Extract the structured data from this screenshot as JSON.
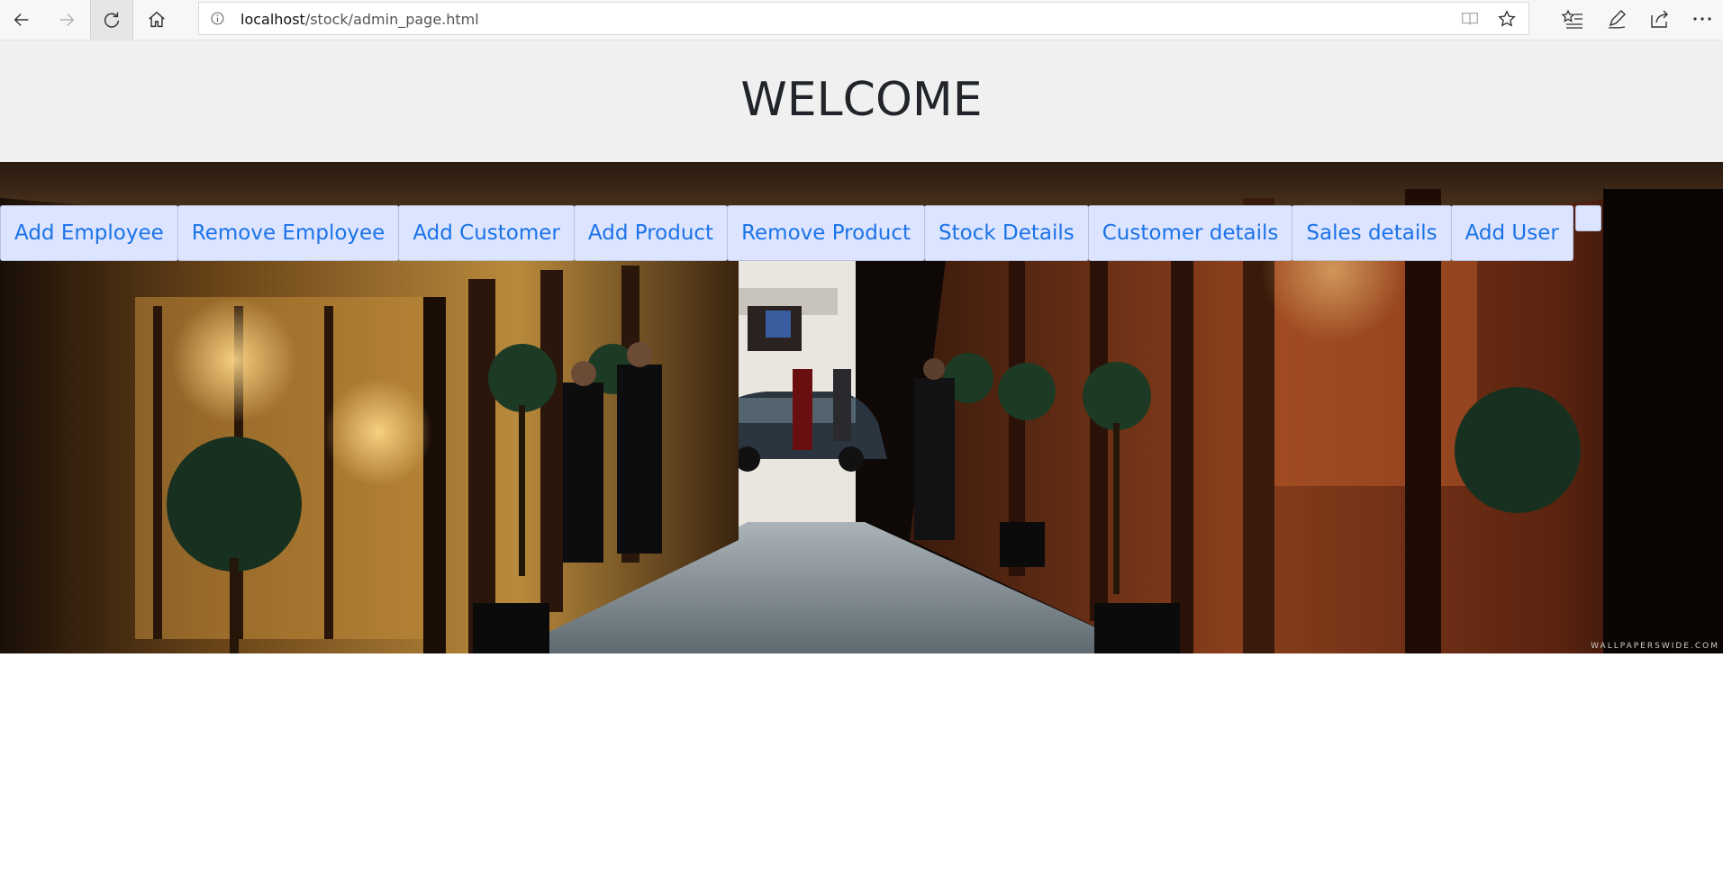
{
  "browser": {
    "url_host": "localhost",
    "url_path": "/stock/admin_page.html"
  },
  "header": {
    "title": "WELCOME"
  },
  "menu": {
    "items": [
      {
        "label": "Add Employee"
      },
      {
        "label": "Remove Employee"
      },
      {
        "label": "Add Customer"
      },
      {
        "label": "Add Product"
      },
      {
        "label": "Remove Product"
      },
      {
        "label": "Stock Details"
      },
      {
        "label": "Customer details"
      },
      {
        "label": "Sales details"
      },
      {
        "label": "Add User"
      }
    ]
  },
  "hero": {
    "watermark": "WALLPAPERSWIDE.COM"
  },
  "colors": {
    "menu_background": "#dde4ff",
    "menu_text": "#1a73e8",
    "header_background": "#f0f0f0"
  }
}
